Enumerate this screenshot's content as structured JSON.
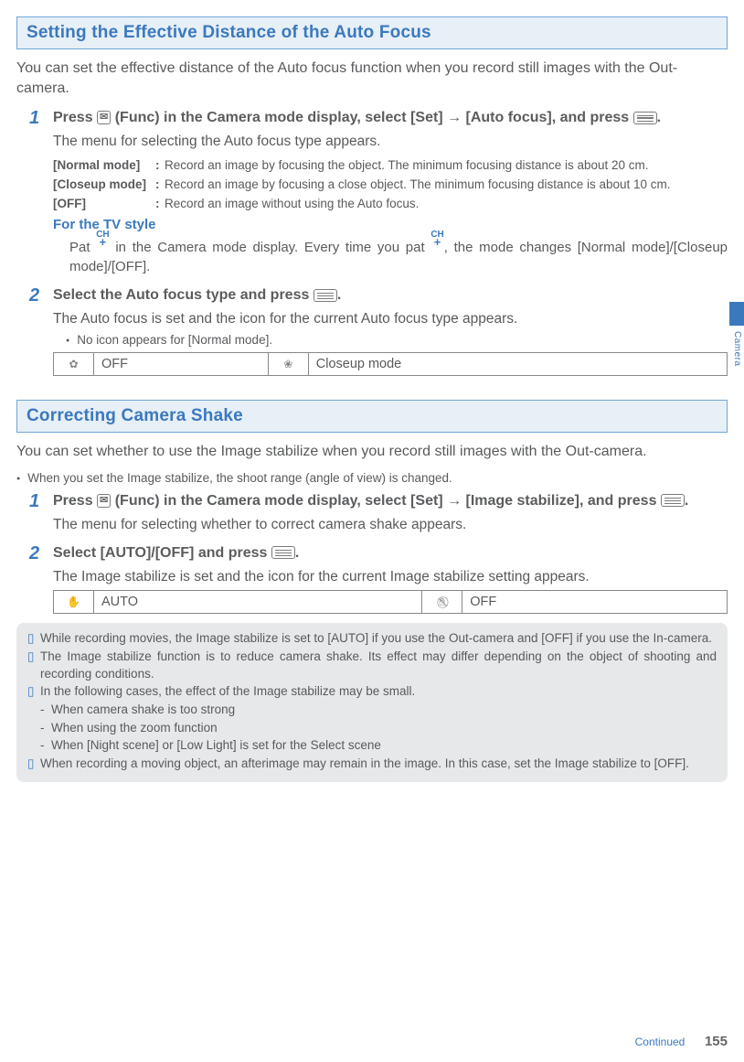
{
  "side_label": "Camera",
  "footer": {
    "continued": "Continued",
    "page": "155"
  },
  "s1": {
    "title": "Setting the Effective Distance of the Auto Focus",
    "intro": "You can set the effective distance of the Auto focus function when you record still images with the Out-camera.",
    "step1": {
      "lead_a": "Press ",
      "lead_b": " (Func) in the Camera mode display, select [Set] → [Auto focus], and press ",
      "lead_c": ".",
      "sub": "The menu for selecting the Auto focus type appears.",
      "modes": {
        "normal_l": "[Normal mode]",
        "normal_d": "Record an image by focusing the object. The minimum focusing distance is about 20 cm.",
        "close_l": "[Closeup mode]",
        "close_d": "Record an image by focusing a close object. The minimum focusing distance is about 10 cm.",
        "off_l": "[OFF]",
        "off_d": "Record an image without using the Auto focus."
      },
      "tv_title": "For the TV style",
      "tv_a": "Pat ",
      "tv_b": " in the Camera mode display. Every time you pat ",
      "tv_c": ", the mode changes [Normal mode]/[Closeup mode]/[OFF]."
    },
    "step2": {
      "lead_a": "Select the Auto focus type and press ",
      "lead_b": ".",
      "sub": "The Auto focus is set and the icon for the current Auto focus type appears.",
      "bullet": "No icon appears for [Normal mode].",
      "tbl": {
        "off": "OFF",
        "close": "Closeup mode"
      }
    }
  },
  "s2": {
    "title": "Correcting Camera Shake",
    "intro": "You can set whether to use the Image stabilize when you record still images with the Out-camera.",
    "bullet_top": "When you set the Image stabilize, the shoot range (angle of view) is changed.",
    "step1": {
      "lead_a": "Press ",
      "lead_b": " (Func) in the Camera mode display, select [Set] → [Image stabilize], and press ",
      "lead_c": ".",
      "sub": "The menu for selecting whether to correct camera shake appears."
    },
    "step2": {
      "lead_a": "Select [AUTO]/[OFF] and press ",
      "lead_b": ".",
      "sub": "The Image stabilize is set and the icon for the current Image stabilize setting appears.",
      "tbl": {
        "auto": "AUTO",
        "off": "OFF"
      }
    },
    "notes": {
      "n1": "While recording movies, the Image stabilize is set to [AUTO] if you use the Out-camera and [OFF] if you use the In-camera.",
      "n2": "The Image stabilize function is to reduce camera shake. Its effect may differ depending on the object of shooting and recording conditions.",
      "n3": "In the following cases, the effect of the Image stabilize may be small.",
      "n3a": "When camera shake is too strong",
      "n3b": "When using the zoom function",
      "n3c": "When [Night scene] or [Low Light] is set for the Select scene",
      "n4": "When recording a moving object, an afterimage may remain in the image. In this case, set the Image stabilize to [OFF]."
    }
  }
}
